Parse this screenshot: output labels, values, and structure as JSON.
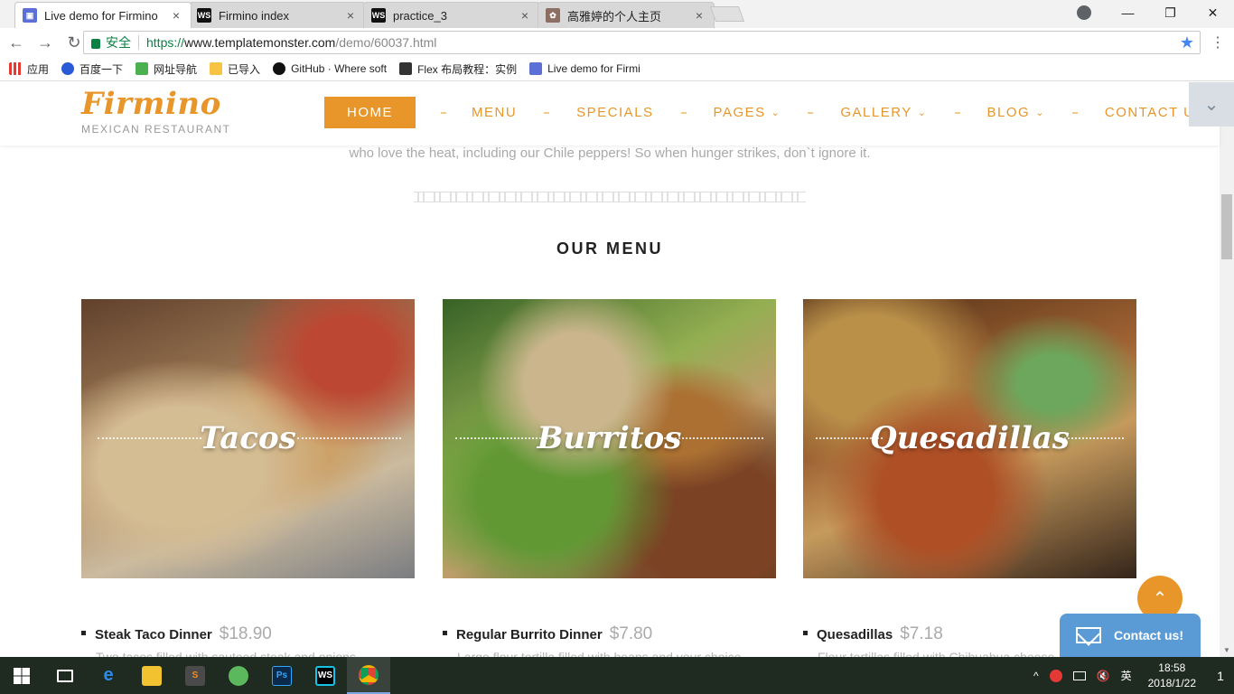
{
  "browser": {
    "tabs": [
      {
        "title": "Live demo for Firmino",
        "favicon": "templatemonster-icon",
        "active": true
      },
      {
        "title": "Firmino index",
        "favicon": "webstorm-icon",
        "active": false
      },
      {
        "title": "practice_3",
        "favicon": "webstorm-icon",
        "active": false
      },
      {
        "title": "高雅婷的个人主页",
        "favicon": "page-icon",
        "active": false
      }
    ],
    "close_glyph": "×",
    "window_controls": {
      "minimize": "—",
      "restore": "❐",
      "close": "✕"
    },
    "nav": {
      "back": "←",
      "forward": "→",
      "reload": "↻"
    },
    "omnibox": {
      "secure_label": "安全",
      "url_scheme": "https://",
      "url_host": "www.templatemonster.com",
      "url_path": "/demo/60037.html",
      "star": "★"
    },
    "menu_glyph": "⋮",
    "bookmarks": [
      {
        "label": "应用",
        "icon": "apps-icon"
      },
      {
        "label": "百度一下",
        "icon": "baidu-icon"
      },
      {
        "label": "网址导航",
        "icon": "hao123-icon"
      },
      {
        "label": "已导入",
        "icon": "folder-icon"
      },
      {
        "label": "GitHub · Where soft",
        "icon": "github-icon"
      },
      {
        "label": "Flex 布局教程：实例",
        "icon": "flex-icon"
      },
      {
        "label": "Live demo for Firmi",
        "icon": "templatemonster-icon"
      }
    ]
  },
  "site": {
    "logo": {
      "name": "Firmino",
      "subtitle": "MEXICAN RESTAURANT"
    },
    "nav": [
      {
        "label": "HOME",
        "active": true,
        "dropdown": false
      },
      {
        "label": "MENU",
        "active": false,
        "dropdown": false
      },
      {
        "label": "SPECIALS",
        "active": false,
        "dropdown": false
      },
      {
        "label": "PAGES",
        "active": false,
        "dropdown": true
      },
      {
        "label": "GALLERY",
        "active": false,
        "dropdown": true
      },
      {
        "label": "BLOG",
        "active": false,
        "dropdown": true
      },
      {
        "label": "CONTACT US",
        "active": false,
        "dropdown": false
      }
    ],
    "caret": "⌄",
    "toggle_glyph": "⌄",
    "intro_text": "who love the heat, including our Chile peppers! So when hunger strikes, don`t ignore it.",
    "section_title": "OUR MENU",
    "cards": [
      {
        "title": "Tacos",
        "item": "Steak Taco Dinner",
        "price": "$18.90",
        "desc": "Two tacos filled with sauteed steak and onions"
      },
      {
        "title": "Burritos",
        "item": "Regular Burrito Dinner",
        "price": "$7.80",
        "desc": "Large flour tortilla filled with beans and your choice"
      },
      {
        "title": "Quesadillas",
        "item": "Quesadillas",
        "price": "$7.18",
        "desc": "Flour tortillas filled with Chihuahua cheese"
      }
    ],
    "scrolltop_glyph": "⌃",
    "contact_widget": "Contact us!",
    "accent_color": "#e8962a"
  },
  "taskbar": {
    "apps": [
      "start-icon",
      "task-view-icon",
      "edge-icon",
      "file-explorer-icon",
      "sublime-icon",
      "browser-360-icon",
      "photoshop-icon",
      "webstorm-icon",
      "chrome-icon"
    ],
    "tray": {
      "chevron": "^",
      "lang": "英",
      "time": "18:58",
      "date": "2018/1/22",
      "notifications": "1"
    }
  },
  "scrollbar": {
    "up": "▲",
    "down": "▼"
  }
}
